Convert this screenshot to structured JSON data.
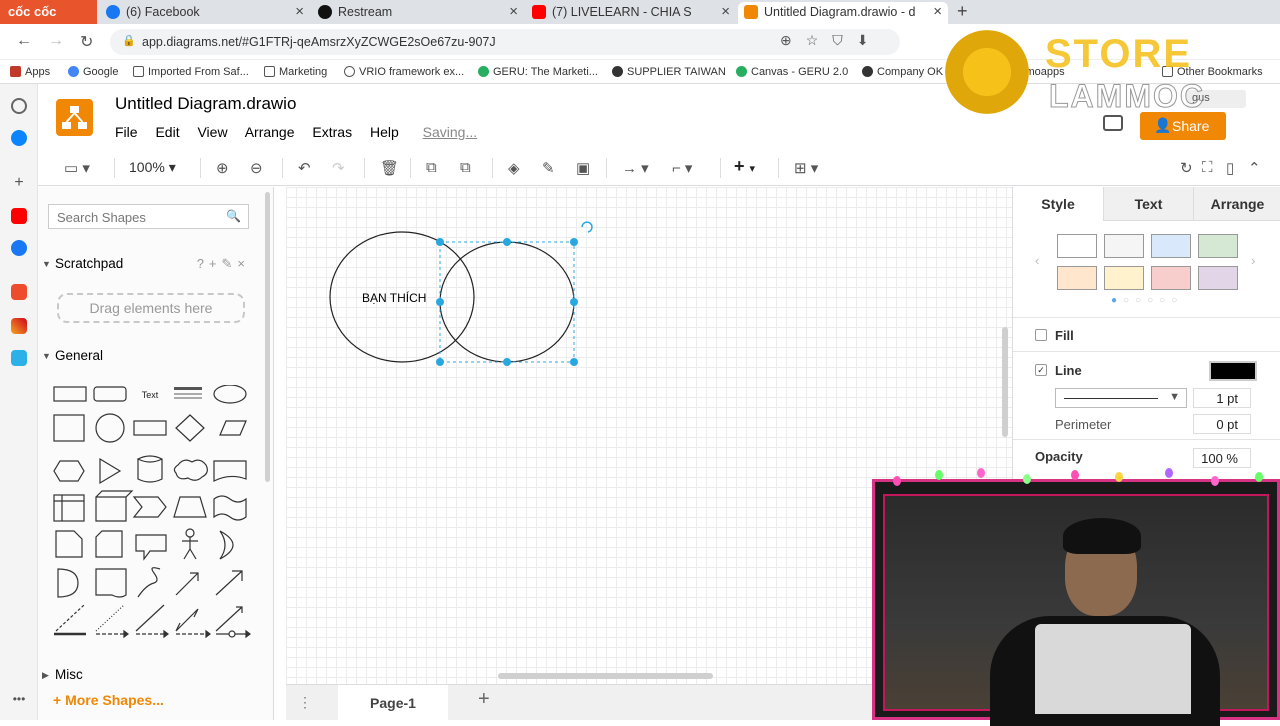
{
  "browser": {
    "brand": "cốc cốc",
    "tabs": [
      {
        "label": "(6) Facebook",
        "color": "#1877f2"
      },
      {
        "label": "Restream",
        "color": "#111111"
      },
      {
        "label": "(7) LIVELEARN - CHIA S",
        "color": "#ff0000"
      },
      {
        "label": "Untitled Diagram.drawio - d",
        "color": "#f08705"
      }
    ],
    "url": "app.diagrams.net/#G1FTRj-qeAmsrzXyZCWGE2sOe67zu-907J",
    "bookmarks": [
      "Apps",
      "Google",
      "Imported From Saf...",
      "Marketing",
      "VRIO framework ex...",
      "GERU: The Marketi...",
      "SUPPLIER TAIWAN",
      "Canvas - GERU 2.0",
      "Company OK",
      "Sumoapps",
      "Other Bookmarks"
    ]
  },
  "app": {
    "title": "Untitled Diagram.drawio",
    "menu": [
      "File",
      "Edit",
      "View",
      "Arrange",
      "Extras",
      "Help"
    ],
    "saving": "Saving...",
    "share": "Share",
    "language": "gus",
    "zoom": "100%"
  },
  "sidebar": {
    "search_placeholder": "Search Shapes",
    "scratchpad": "Scratchpad",
    "drag_here": "Drag elements here",
    "general": "General",
    "text_shape": "Text",
    "misc": "Misc",
    "more_shapes": "More Shapes..."
  },
  "canvas": {
    "circle_label": "BẠN THÍCH"
  },
  "pages": {
    "current": "Page-1"
  },
  "format_panel": {
    "tabs": [
      "Style",
      "Text",
      "Arrange"
    ],
    "swatches": [
      "#ffffff",
      "#f5f5f5",
      "#dae8fc",
      "#d5e8d4",
      "#ffe6cc",
      "#fff2cc",
      "#f8cecc",
      "#e1d5e7"
    ],
    "fill_label": "Fill",
    "line_label": "Line",
    "line_width": "1 pt",
    "perimeter_label": "Perimeter",
    "perimeter_value": "0 pt",
    "opacity_label": "Opacity",
    "opacity_value": "100 %"
  },
  "watermark": {
    "line1": "STORE",
    "line2": "LAMMOC"
  }
}
